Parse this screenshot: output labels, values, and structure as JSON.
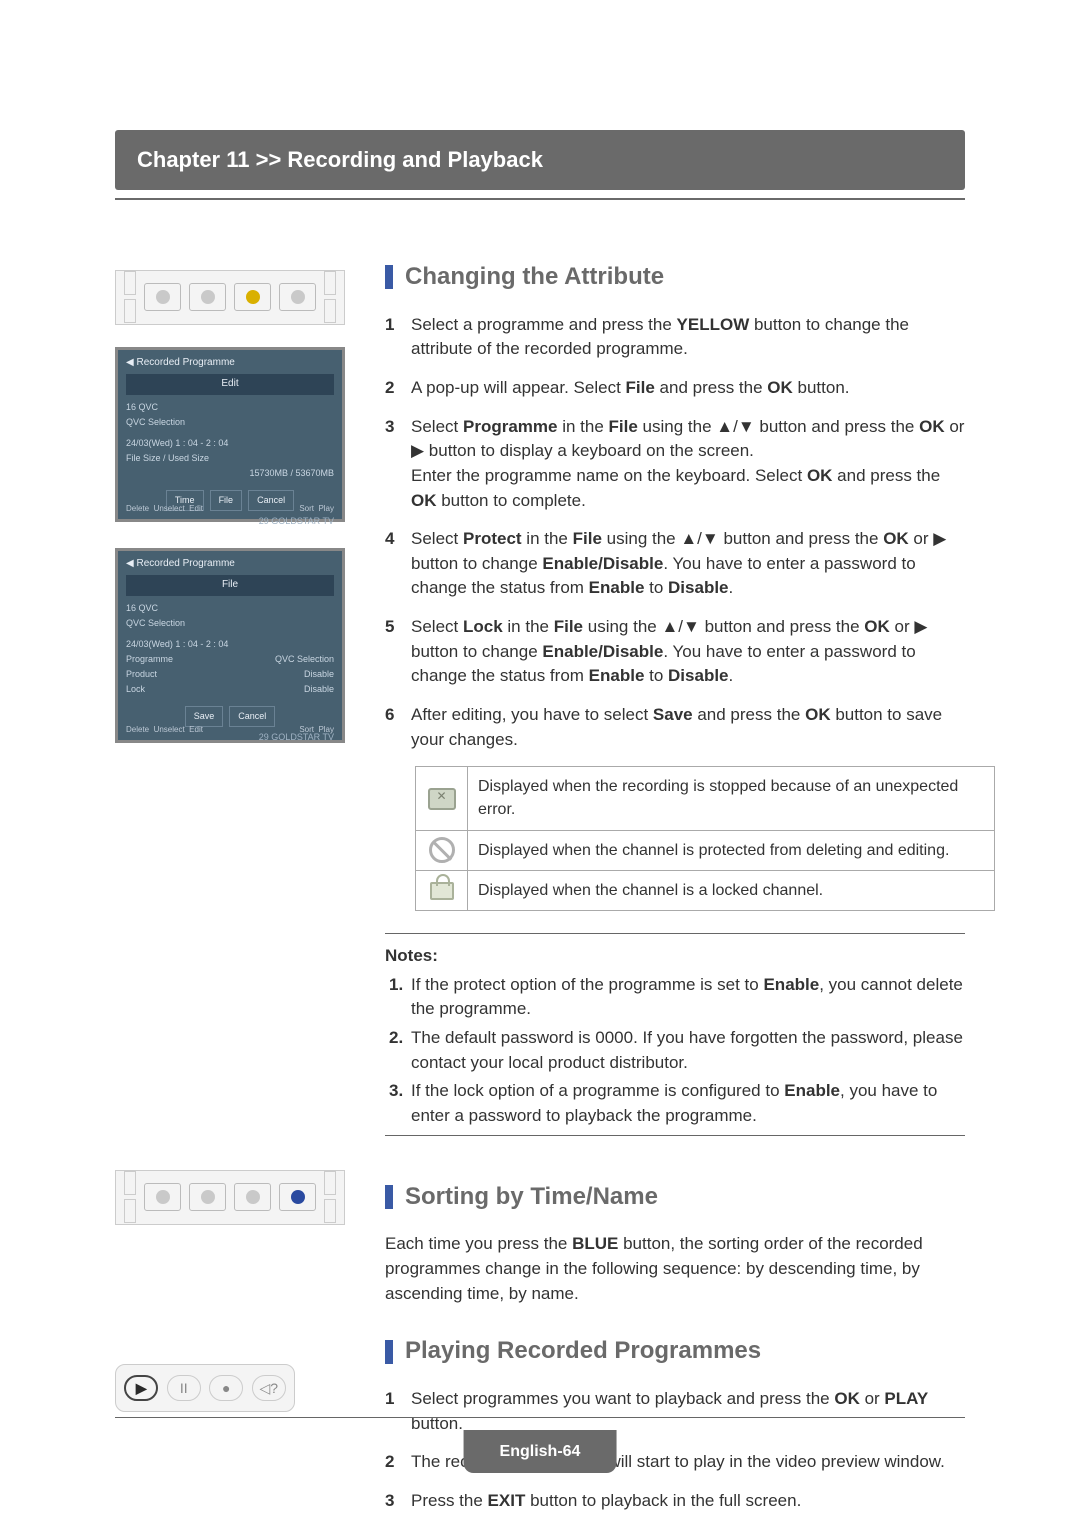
{
  "chapter_title": "Chapter 11 >> Recording and Playback",
  "sections": {
    "attr": {
      "title": "Changing the Attribute",
      "step1_a": "Select a programme and press the ",
      "step1_b": "YELLOW",
      "step1_c": " button to change the attribute of the recorded programme.",
      "step2_a": "A pop-up will appear. Select ",
      "step2_b": "File",
      "step2_c": " and press the ",
      "step2_d": "OK",
      "step2_e": " button.",
      "step3_a": "Select ",
      "step3_b": "Programme",
      "step3_c": " in the ",
      "step3_d": "File",
      "step3_e": " using the ",
      "step3_f": " button and press the ",
      "step3_g": "OK",
      "step3_h": " or ",
      "step3_i": " button to display a keyboard on the screen.",
      "step3_j": "Enter the programme name on the keyboard. Select ",
      "step3_k": "OK",
      "step3_l": " and press the ",
      "step3_m": "OK",
      "step3_n": " button to complete.",
      "step4_a": "Select ",
      "step4_b": "Protect",
      "step4_c": " in the ",
      "step4_d": "File",
      "step4_e": " using the ",
      "step4_f": " button and press the ",
      "step4_g": "OK",
      "step4_h": " or ",
      "step4_i": " button to change ",
      "step4_j": "Enable/Disable",
      "step4_k": ". You have to enter a password to change the status from ",
      "step4_l": "Enable",
      "step4_m": " to ",
      "step4_n": "Disable",
      "step4_o": ".",
      "step5_a": "Select ",
      "step5_b": "Lock",
      "step5_c": " in the ",
      "step5_d": "File",
      "step5_e": " using the ",
      "step5_f": " button and press the ",
      "step5_g": "OK",
      "step5_h": " or ",
      "step5_i": " button to change ",
      "step5_j": "Enable/Disable",
      "step5_k": ". You have to enter a password to change the status from ",
      "step5_l": "Enable",
      "step5_m": " to ",
      "step5_n": "Disable",
      "step5_o": ".",
      "step6_a": " After editing, you have to select ",
      "step6_b": "Save",
      "step6_c": " and press the ",
      "step6_d": "OK",
      "step6_e": " button to save your changes.",
      "table": {
        "row1": "Displayed when the recording is stopped because of an unexpected error.",
        "row2": "Displayed when the channel is protected from deleting and editing.",
        "row3": "Displayed when the channel is a locked channel."
      },
      "notes_title": "Notes:",
      "note1_a": "If the protect option of the programme is set to ",
      "note1_b": "Enable",
      "note1_c": ", you cannot delete the programme.",
      "note2": "The default password is 0000. If you have forgotten the password, please contact your local product distributor.",
      "note3_a": "If the lock option of a programme is configured to ",
      "note3_b": "Enable",
      "note3_c": ", you have to enter a password to playback the programme."
    },
    "sort": {
      "title": "Sorting by Time/Name",
      "body_a": "Each time you press the ",
      "body_b": "BLUE",
      "body_c": " button, the sorting order of the recorded programmes change in the following sequence: by descending time, by ascending time, by name."
    },
    "play": {
      "title": "Playing Recorded Programmes",
      "step1_a": "Select programmes you want to playback and press the ",
      "step1_b": "OK",
      "step1_c": " or ",
      "step1_d": "PLAY",
      "step1_e": " button.",
      "step2": "The recorded programme will start to play in the video preview window.",
      "step3_a": "Press the ",
      "step3_b": "EXIT",
      "step3_c": " button to playback in the full screen."
    }
  },
  "screens": {
    "title": "Recorded Programme",
    "edit_tab": "Edit",
    "file_tab": "File",
    "ch": "16 QVC",
    "sub": "QVC Selection",
    "dt": "24/03(Wed) 1 : 04 - 2 : 04",
    "fs_label": "File Size / Used Size",
    "fs_value": "15730MB / 53670MB",
    "btn_time": "Time",
    "btn_file": "File",
    "btn_cancel": "Cancel",
    "btn_save": "Save",
    "pair_prog_l": "Programme",
    "pair_prog_v": "QVC Selection",
    "pair_prot_l": "Product",
    "pair_prot_v": "Disable",
    "pair_lock_l": "Lock",
    "pair_lock_v": "Disable",
    "foot_delete": "Delete",
    "foot_unselect": "Unselect",
    "foot_edit": "Edit",
    "foot_sort": "Sort",
    "foot_play": "Play",
    "foot_span": "29 GOLDSTAR TV"
  },
  "nums": {
    "n1": "1",
    "n2": "2",
    "n3": "3",
    "n4": "4",
    "n5": "5",
    "n6": "6",
    "nn1": "1.",
    "nn2": "2.",
    "nn3": "3."
  },
  "arrows": {
    "updown": "▲/▼",
    "right": "▶"
  },
  "play_glyphs": {
    "play": "▶",
    "pause": "II",
    "stop": "●",
    "rew": "◁?"
  },
  "page_label": "English-64"
}
